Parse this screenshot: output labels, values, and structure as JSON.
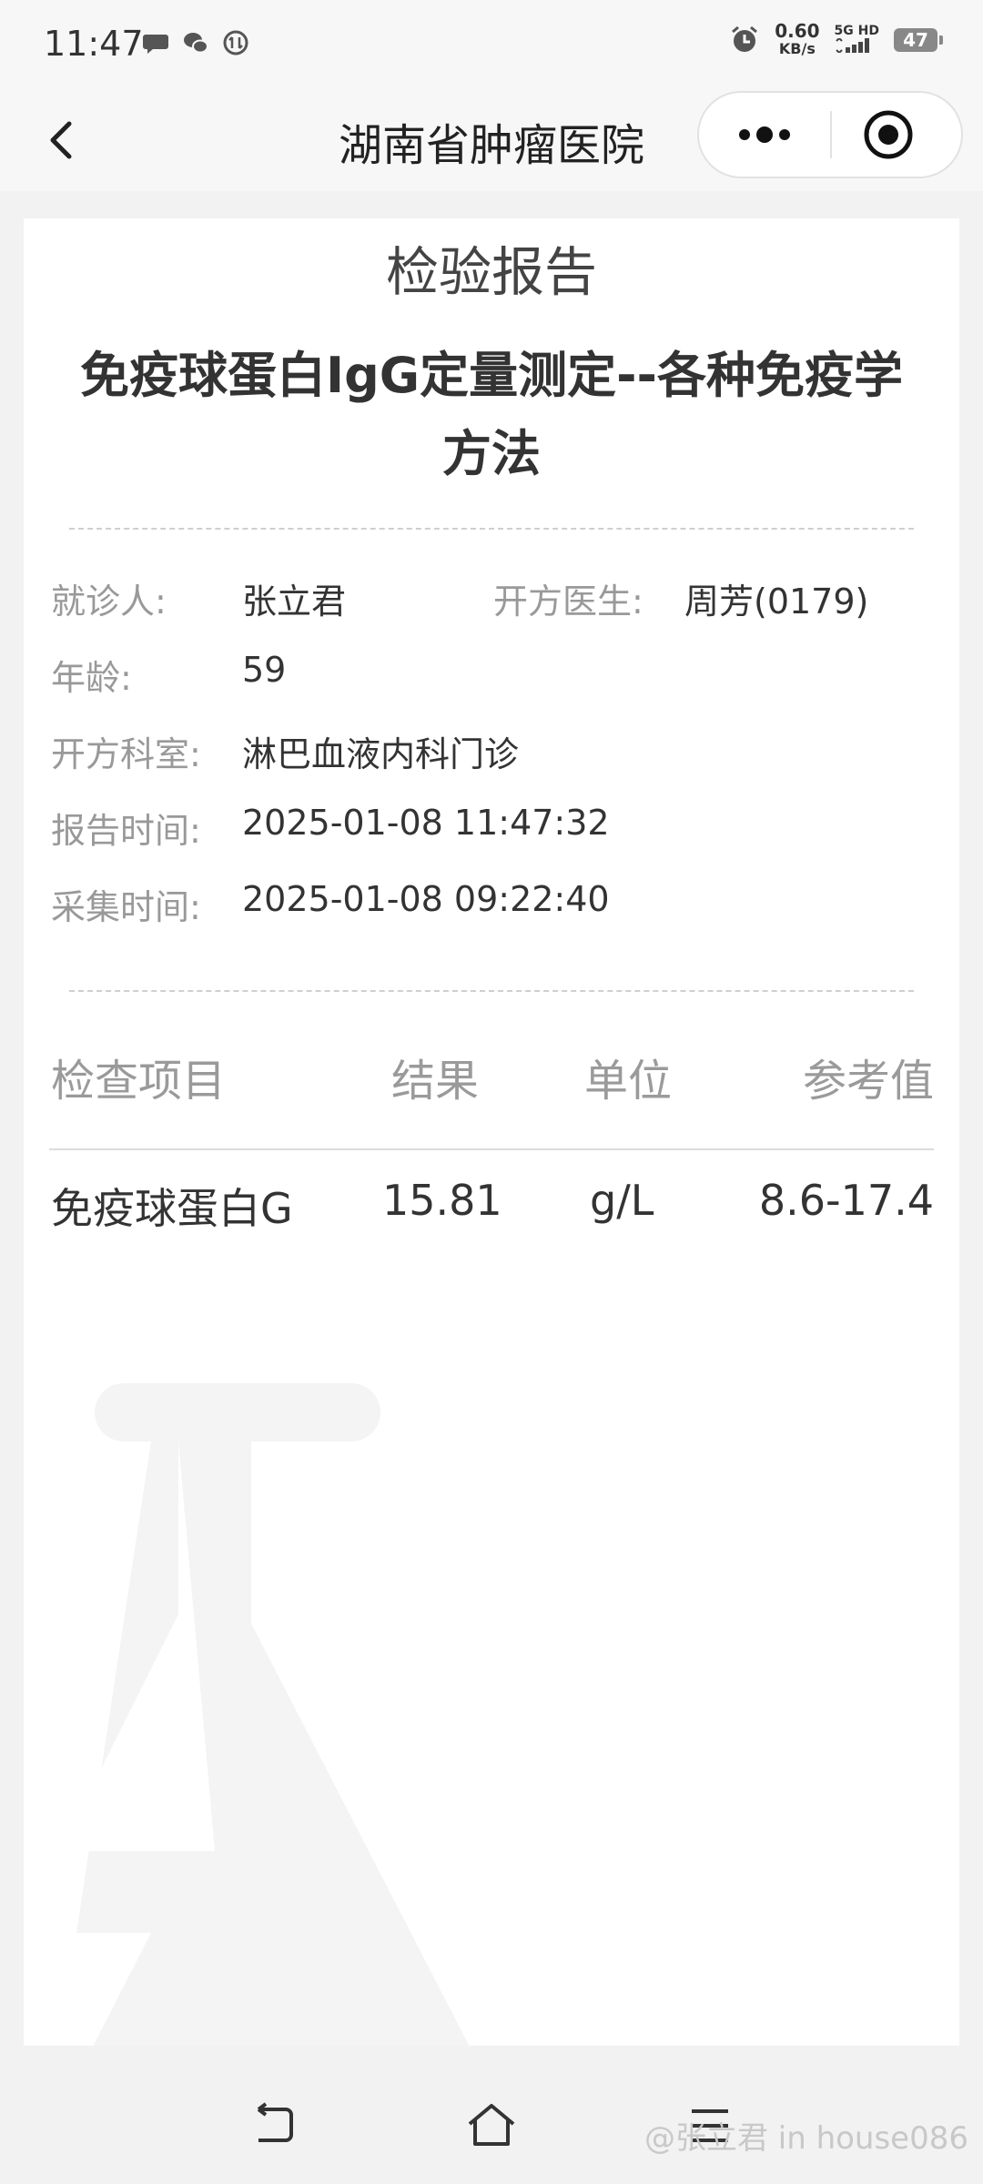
{
  "status_bar": {
    "time": "11:47",
    "net_speed_value": "0.60",
    "net_speed_unit": "KB/s",
    "network": "5G HD",
    "battery": "47"
  },
  "nav": {
    "title": "湖南省肿瘤医院"
  },
  "report": {
    "heading": "检验报告",
    "test_name": "免疫球蛋白IgG定量测定--各种免疫学方法",
    "info": {
      "patient_label": "就诊人:",
      "patient_value": "张立君",
      "doctor_label": "开方医生:",
      "doctor_value": "周芳(0179)",
      "age_label": "年龄:",
      "age_value": "59",
      "dept_label": "开方科室:",
      "dept_value": "淋巴血液内科门诊",
      "report_time_label": "报告时间:",
      "report_time_value": "2025-01-08 11:47:32",
      "collect_time_label": "采集时间:",
      "collect_time_value": "2025-01-08 09:22:40"
    },
    "table": {
      "headers": [
        "检查项目",
        "结果",
        "单位",
        "参考值"
      ],
      "rows": [
        {
          "item": "免疫球蛋白G",
          "result": "15.81",
          "unit": "g/L",
          "reference": "8.6-17.4"
        }
      ]
    }
  },
  "bottom_nav": {
    "watermark": "@张立君 in house086"
  },
  "icons": {
    "back": "chevron-left-icon",
    "more": "more-dots-icon",
    "close": "target-icon",
    "flask": "flask-icon",
    "sys_back": "back-arrow-icon",
    "sys_home": "home-icon",
    "sys_menu": "menu-icon"
  },
  "colors": {
    "label_gray": "#999999",
    "text_dark": "#333333",
    "background": "#f2f2f2"
  }
}
